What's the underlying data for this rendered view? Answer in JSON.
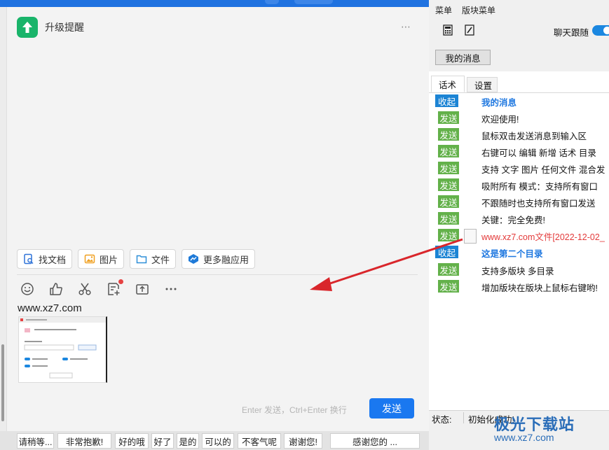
{
  "colors": {
    "accent": "#1a78f0",
    "send_badge": "#63b14a",
    "fold_badge": "#1c84d4",
    "link_red": "#e33a3a",
    "arrow_red": "#d9262b",
    "upgrade_green": "#19b46a"
  },
  "chat": {
    "upgrade_label": "升级提醒",
    "more_icon": "⋯",
    "app_buttons": [
      {
        "label": "找文档",
        "icon": "doc-search-icon"
      },
      {
        "label": "图片",
        "icon": "image-icon"
      },
      {
        "label": "文件",
        "icon": "folder-icon"
      },
      {
        "label": "更多融应用",
        "icon": "apps-icon"
      }
    ],
    "tool_icons": [
      "emoji-icon",
      "thumbs-up-icon",
      "scissors-icon",
      "note-add-icon",
      "share-upload-icon",
      "more-icon"
    ],
    "input_text": "www.xz7.com",
    "hint": "Enter 发送，Ctrl+Enter 换行",
    "send_label": "发送"
  },
  "phrases": [
    "请稍等...",
    "非常抱歉!",
    "好的哦",
    "好了",
    "是的",
    "可以的",
    "不客气呢",
    "谢谢您!",
    "感谢您的 ..."
  ],
  "panel": {
    "menus": [
      "菜单",
      "版块菜单"
    ],
    "icons": [
      "calculator-icon",
      "edit-icon"
    ],
    "follow_label": "聊天跟随",
    "follow_on": true,
    "my_messages_button": "我的消息",
    "tabs": [
      "话术",
      "设置"
    ],
    "rows": [
      {
        "type": "fold",
        "badge": "收起",
        "text": "我的消息"
      },
      {
        "type": "send",
        "badge": "发送",
        "text": "欢迎使用!"
      },
      {
        "type": "send",
        "badge": "发送",
        "text": "鼠标双击发送消息到输入区"
      },
      {
        "type": "send",
        "badge": "发送",
        "text": "右键可以 编辑 新增 话术 目录"
      },
      {
        "type": "send",
        "badge": "发送",
        "text": "支持 文字 图片 任何文件 混合发"
      },
      {
        "type": "send",
        "badge": "发送",
        "text": "吸附所有 模式：支持所有窗口"
      },
      {
        "type": "send",
        "badge": "发送",
        "text": "不跟随时也支持所有窗口发送"
      },
      {
        "type": "send",
        "badge": "发送",
        "text": "关键：完全免费!"
      },
      {
        "type": "file",
        "badge": "发送",
        "text": "www.xz7.com文件[2022-12-02_"
      },
      {
        "type": "fold",
        "badge": "收起",
        "text": "这是第二个目录"
      },
      {
        "type": "send",
        "badge": "发送",
        "text": "支持多版块 多目录"
      },
      {
        "type": "send",
        "badge": "发送",
        "text": "增加版块在版块上鼠标右键哟!"
      }
    ],
    "status_label": "状态:",
    "status_value": "初始化成功!"
  },
  "watermark": {
    "title": "极光下载站",
    "url": "www.xz7.com"
  }
}
